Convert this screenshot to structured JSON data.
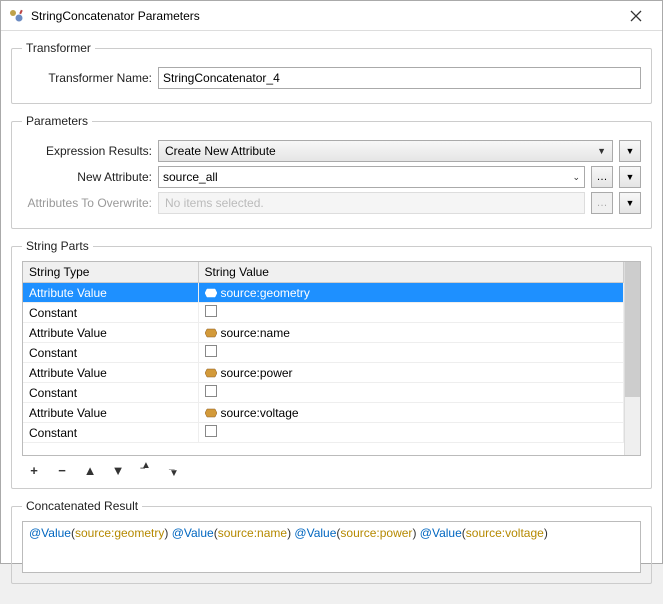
{
  "window": {
    "title": "StringConcatenator Parameters"
  },
  "transformer": {
    "legend": "Transformer",
    "name_label": "Transformer Name:",
    "name_value": "StringConcatenator_4"
  },
  "parameters": {
    "legend": "Parameters",
    "expr_label": "Expression Results:",
    "expr_value": "Create New Attribute",
    "new_attr_label": "New Attribute:",
    "new_attr_value": "source_all",
    "overwrite_label": "Attributes To Overwrite:",
    "overwrite_placeholder": "No items selected."
  },
  "string_parts": {
    "legend": "String Parts",
    "col_type": "String Type",
    "col_value": "String Value",
    "rows": [
      {
        "type": "Attribute Value",
        "value": "source:geometry",
        "icon": "attr",
        "selected": true
      },
      {
        "type": "Constant",
        "value": "",
        "icon": "box",
        "selected": false
      },
      {
        "type": "Attribute Value",
        "value": "source:name",
        "icon": "attr",
        "selected": false
      },
      {
        "type": "Constant",
        "value": "",
        "icon": "box",
        "selected": false
      },
      {
        "type": "Attribute Value",
        "value": "source:power",
        "icon": "attr",
        "selected": false
      },
      {
        "type": "Constant",
        "value": "",
        "icon": "box",
        "selected": false
      },
      {
        "type": "Attribute Value",
        "value": "source:voltage",
        "icon": "attr",
        "selected": false
      },
      {
        "type": "Constant",
        "value": "",
        "icon": "box",
        "selected": false
      }
    ]
  },
  "result": {
    "legend": "Concatenated Result",
    "fn": "@Value",
    "attrs": [
      "source:geometry",
      "source:name",
      "source:power",
      "source:voltage"
    ]
  }
}
